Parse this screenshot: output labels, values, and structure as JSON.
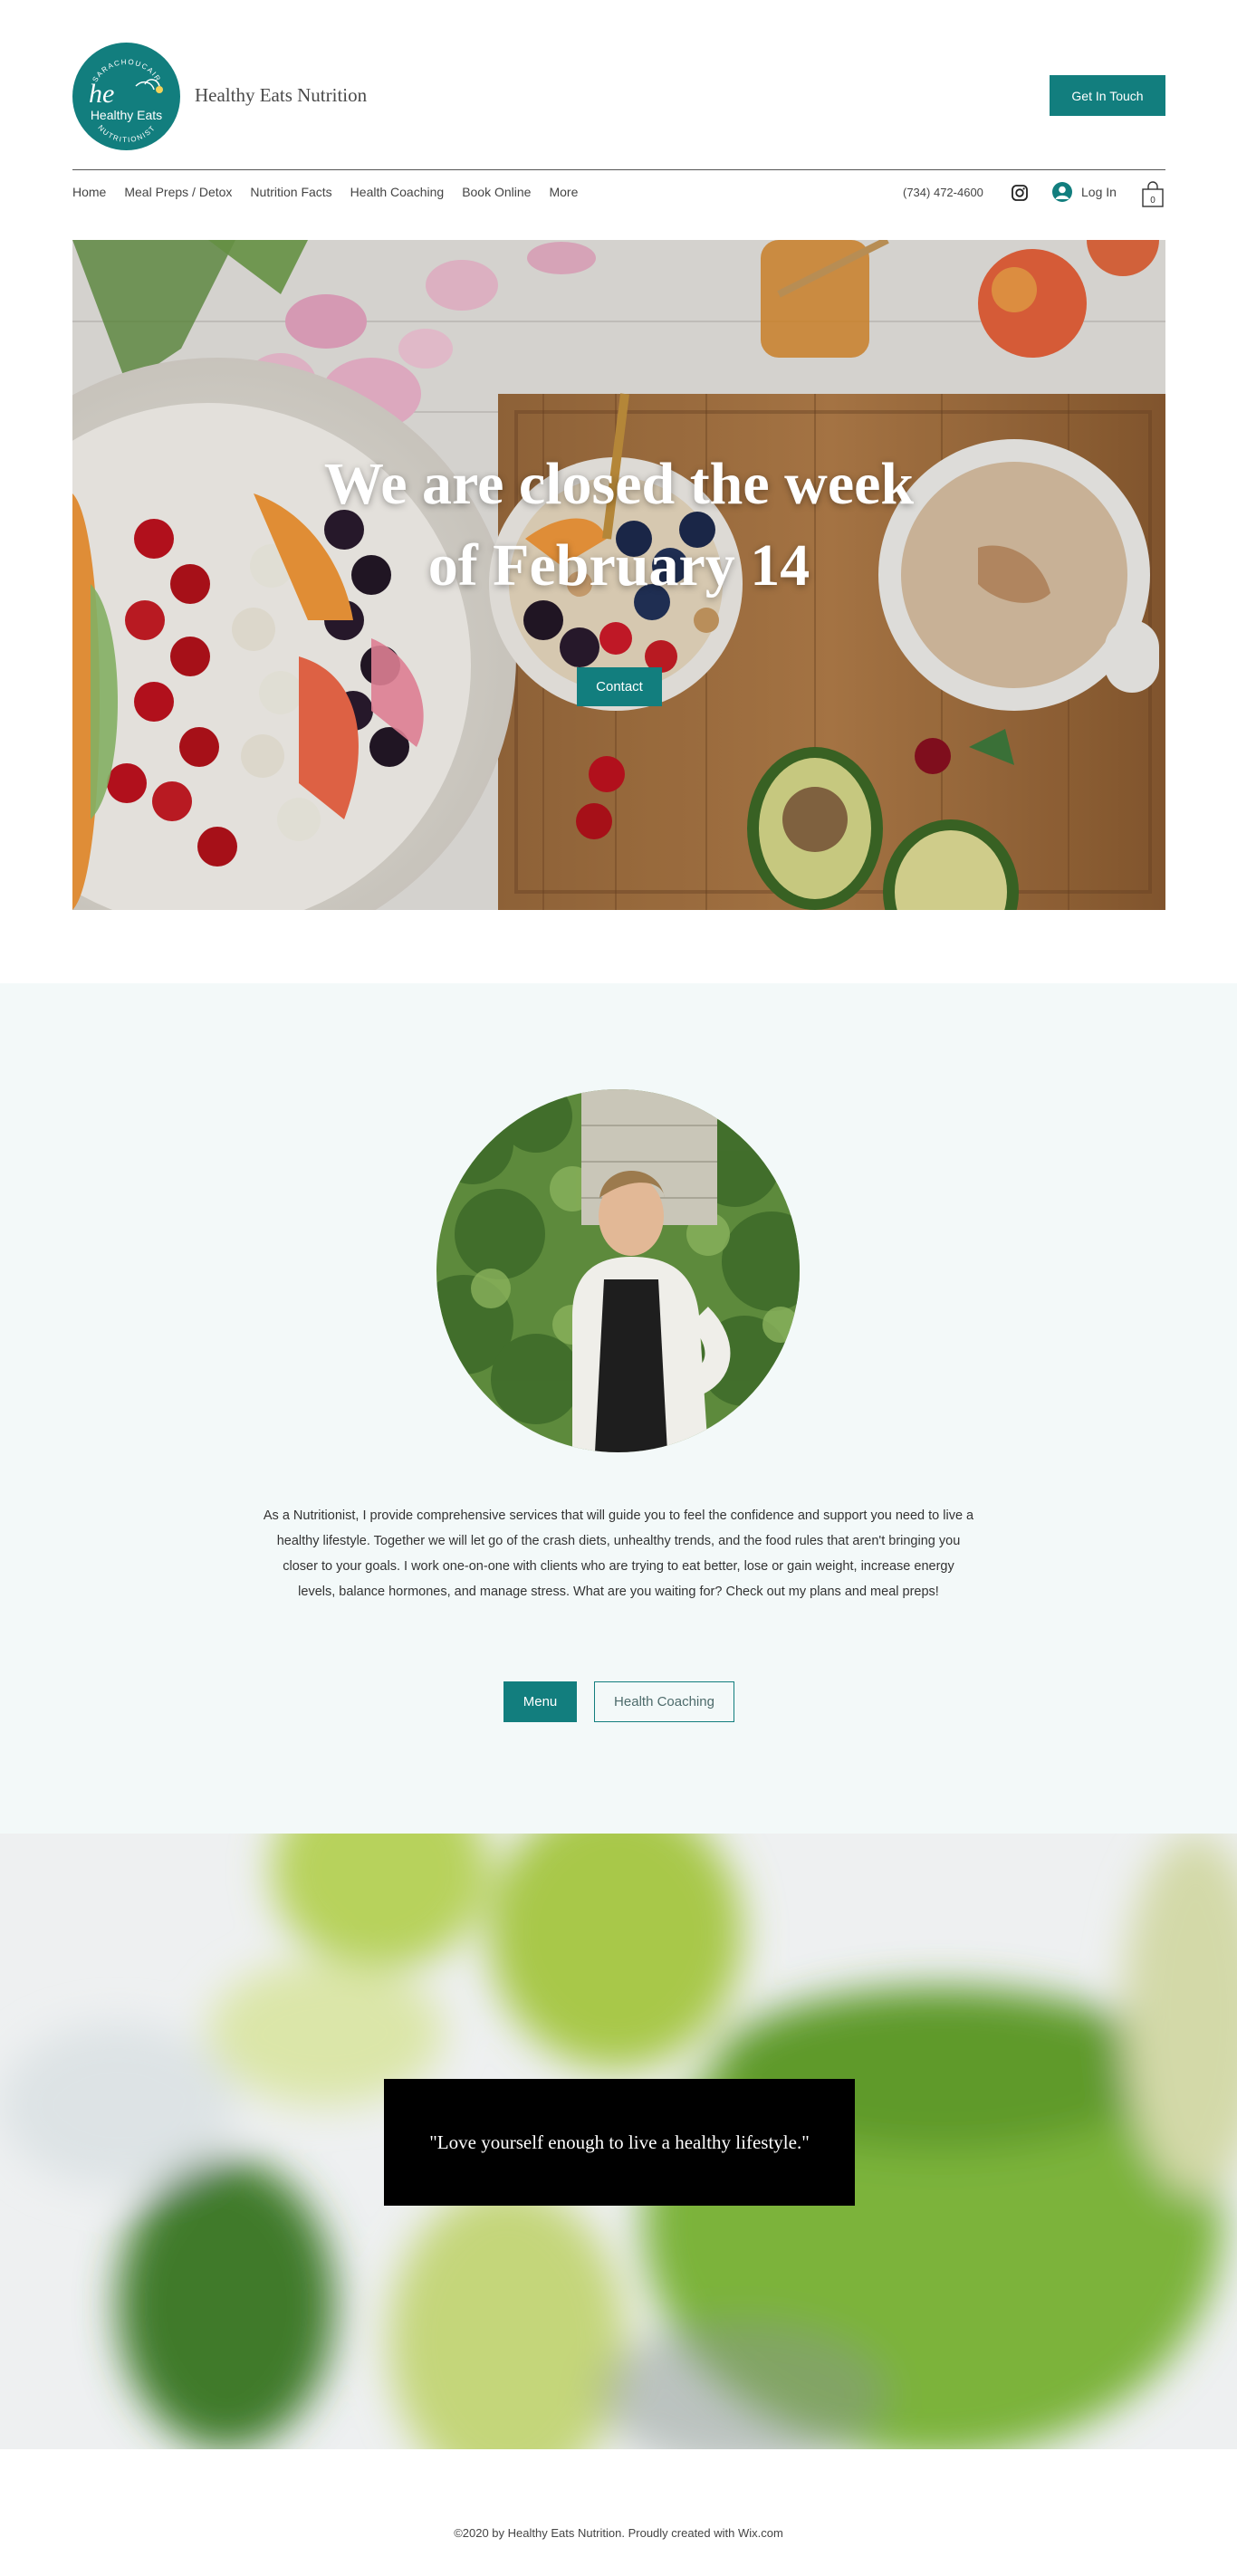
{
  "header": {
    "logo": {
      "initials": "he",
      "top_text": "SARACHOUCAIR",
      "name": "Healthy Eats",
      "bottom_text": "NUTRITIONIST"
    },
    "brand": "Healthy Eats Nutrition",
    "cta_label": "Get In Touch"
  },
  "nav": {
    "items": [
      {
        "label": "Home"
      },
      {
        "label": "Meal Preps / Detox"
      },
      {
        "label": "Nutrition Facts"
      },
      {
        "label": "Health Coaching"
      },
      {
        "label": "Book Online"
      },
      {
        "label": "More"
      }
    ],
    "phone": "(734) 472-4600",
    "social_icon": "instagram-icon",
    "login_label": "Log In",
    "cart_count": "0"
  },
  "hero": {
    "title_line1": "We are closed the week",
    "title_line2": "of February 14",
    "button_label": "Contact"
  },
  "about": {
    "text": "As a Nutritionist, I provide comprehensive services that will guide you to feel the confidence and support you need to live a healthy lifestyle. Together we will let go of the crash diets, unhealthy trends, and the food rules that aren't bringing you closer to your goals. I work one-on-one with clients who are trying to eat better, lose or gain weight, increase energy levels, balance hormones, and manage stress. What are you waiting for? Check out my plans and meal preps!",
    "menu_button": "Menu",
    "coaching_button": "Health Coaching"
  },
  "quote": {
    "text": "\"Love yourself enough to live a healthy lifestyle.\""
  },
  "footer": {
    "text": "©2020 by Healthy Eats Nutrition. Proudly created with Wix.com"
  },
  "colors": {
    "accent": "#127e7e",
    "about_bg": "#f3f9f9",
    "quote_bg": "#000000"
  }
}
